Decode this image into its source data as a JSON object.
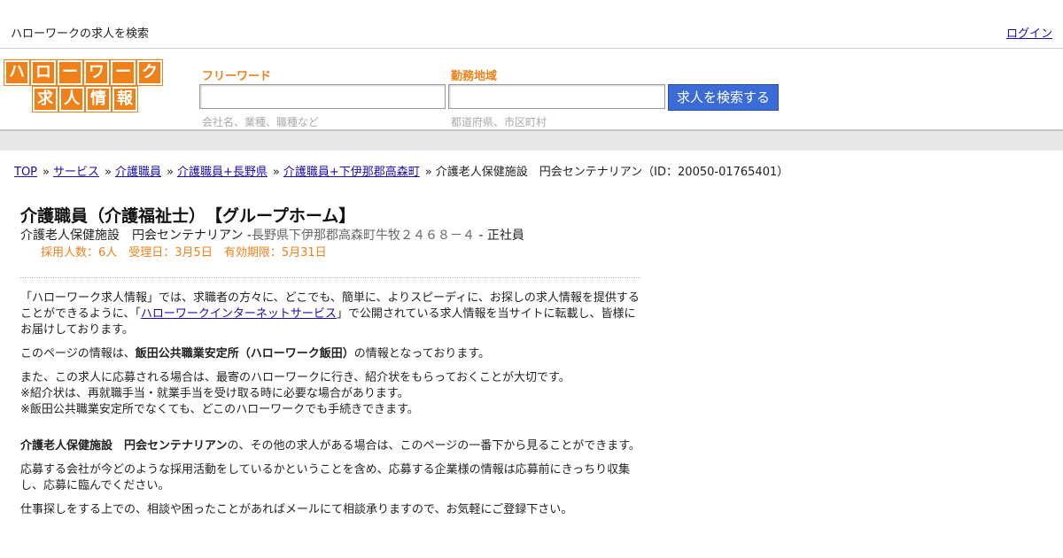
{
  "topbar": {
    "tagline": "ハローワークの求人を検索",
    "login": "ログイン"
  },
  "logo": {
    "row1": [
      "ハ",
      "ロ",
      "ー",
      "ワ",
      "ー",
      "ク"
    ],
    "row2": [
      "求",
      "人",
      "情",
      "報"
    ],
    "color": "#f08018"
  },
  "search": {
    "keyword_label": "フリーワード",
    "keyword_hint": "会社名、業種、職種など",
    "keyword_value": "",
    "area_label": "勤務地域",
    "area_hint": "都道府県、市区町村",
    "area_value": "",
    "button": "求人を検索する"
  },
  "breadcrumb": {
    "items": [
      "TOP",
      "サービス",
      "介護職員",
      "介護職員+長野県",
      "介護職員+下伊那郡高森町"
    ],
    "current": "介護老人保健施設　円会センテナリアン（ID：20050-01765401）",
    "sep": "»"
  },
  "job": {
    "title": "介護職員（介護福祉士）　【グループホーム】",
    "company": "介護老人保健施設　円会センテナリアン",
    "dash1": " -",
    "address": "長野県下伊那郡高森町牛牧２４６８－４",
    "dash2": " - ",
    "employment": "正社員",
    "meta": "採用人数：6人　受理日：3月5日　有効期限：5月31日"
  },
  "body": {
    "p1_a": "「ハローワーク求人情報」では、求職者の方々に、どこでも、簡単に、よりスピーディに、お探しの求人情報を提供することができるように、「",
    "p1_link": "ハローワークインターネットサービス",
    "p1_b": "」で公開されている求人情報を当サイトに転載し、皆様にお届けしております。",
    "p2_a": "このページの情報は、",
    "p2_bold": "飯田公共職業安定所（ハローワーク飯田）",
    "p2_b": "の情報となっております。",
    "p3_l1": "また、この求人に応募される場合は、最寄のハローワークに行き、紹介状をもらっておくことが大切です。",
    "p3_l2": "※紹介状は、再就職手当・就業手当を受け取る時に必要な場合があります。",
    "p3_l3": "※飯田公共職業安定所でなくても、どこのハローワークでも手続きできます。",
    "p4_bold": "介護老人保健施設　円会センテナリアン",
    "p4_b": "の、その他の求人がある場合は、このページの一番下から見ることができます。",
    "p5": "応募する会社が今どのような採用活動をしているかということを含め、応募する企業様の情報は応募前にきっちり収集し、応募に臨んでください。",
    "p6": "仕事探しをする上での、相談や困ったことがあればメールにて相談承りますので、お気軽にご登録下さい。"
  }
}
